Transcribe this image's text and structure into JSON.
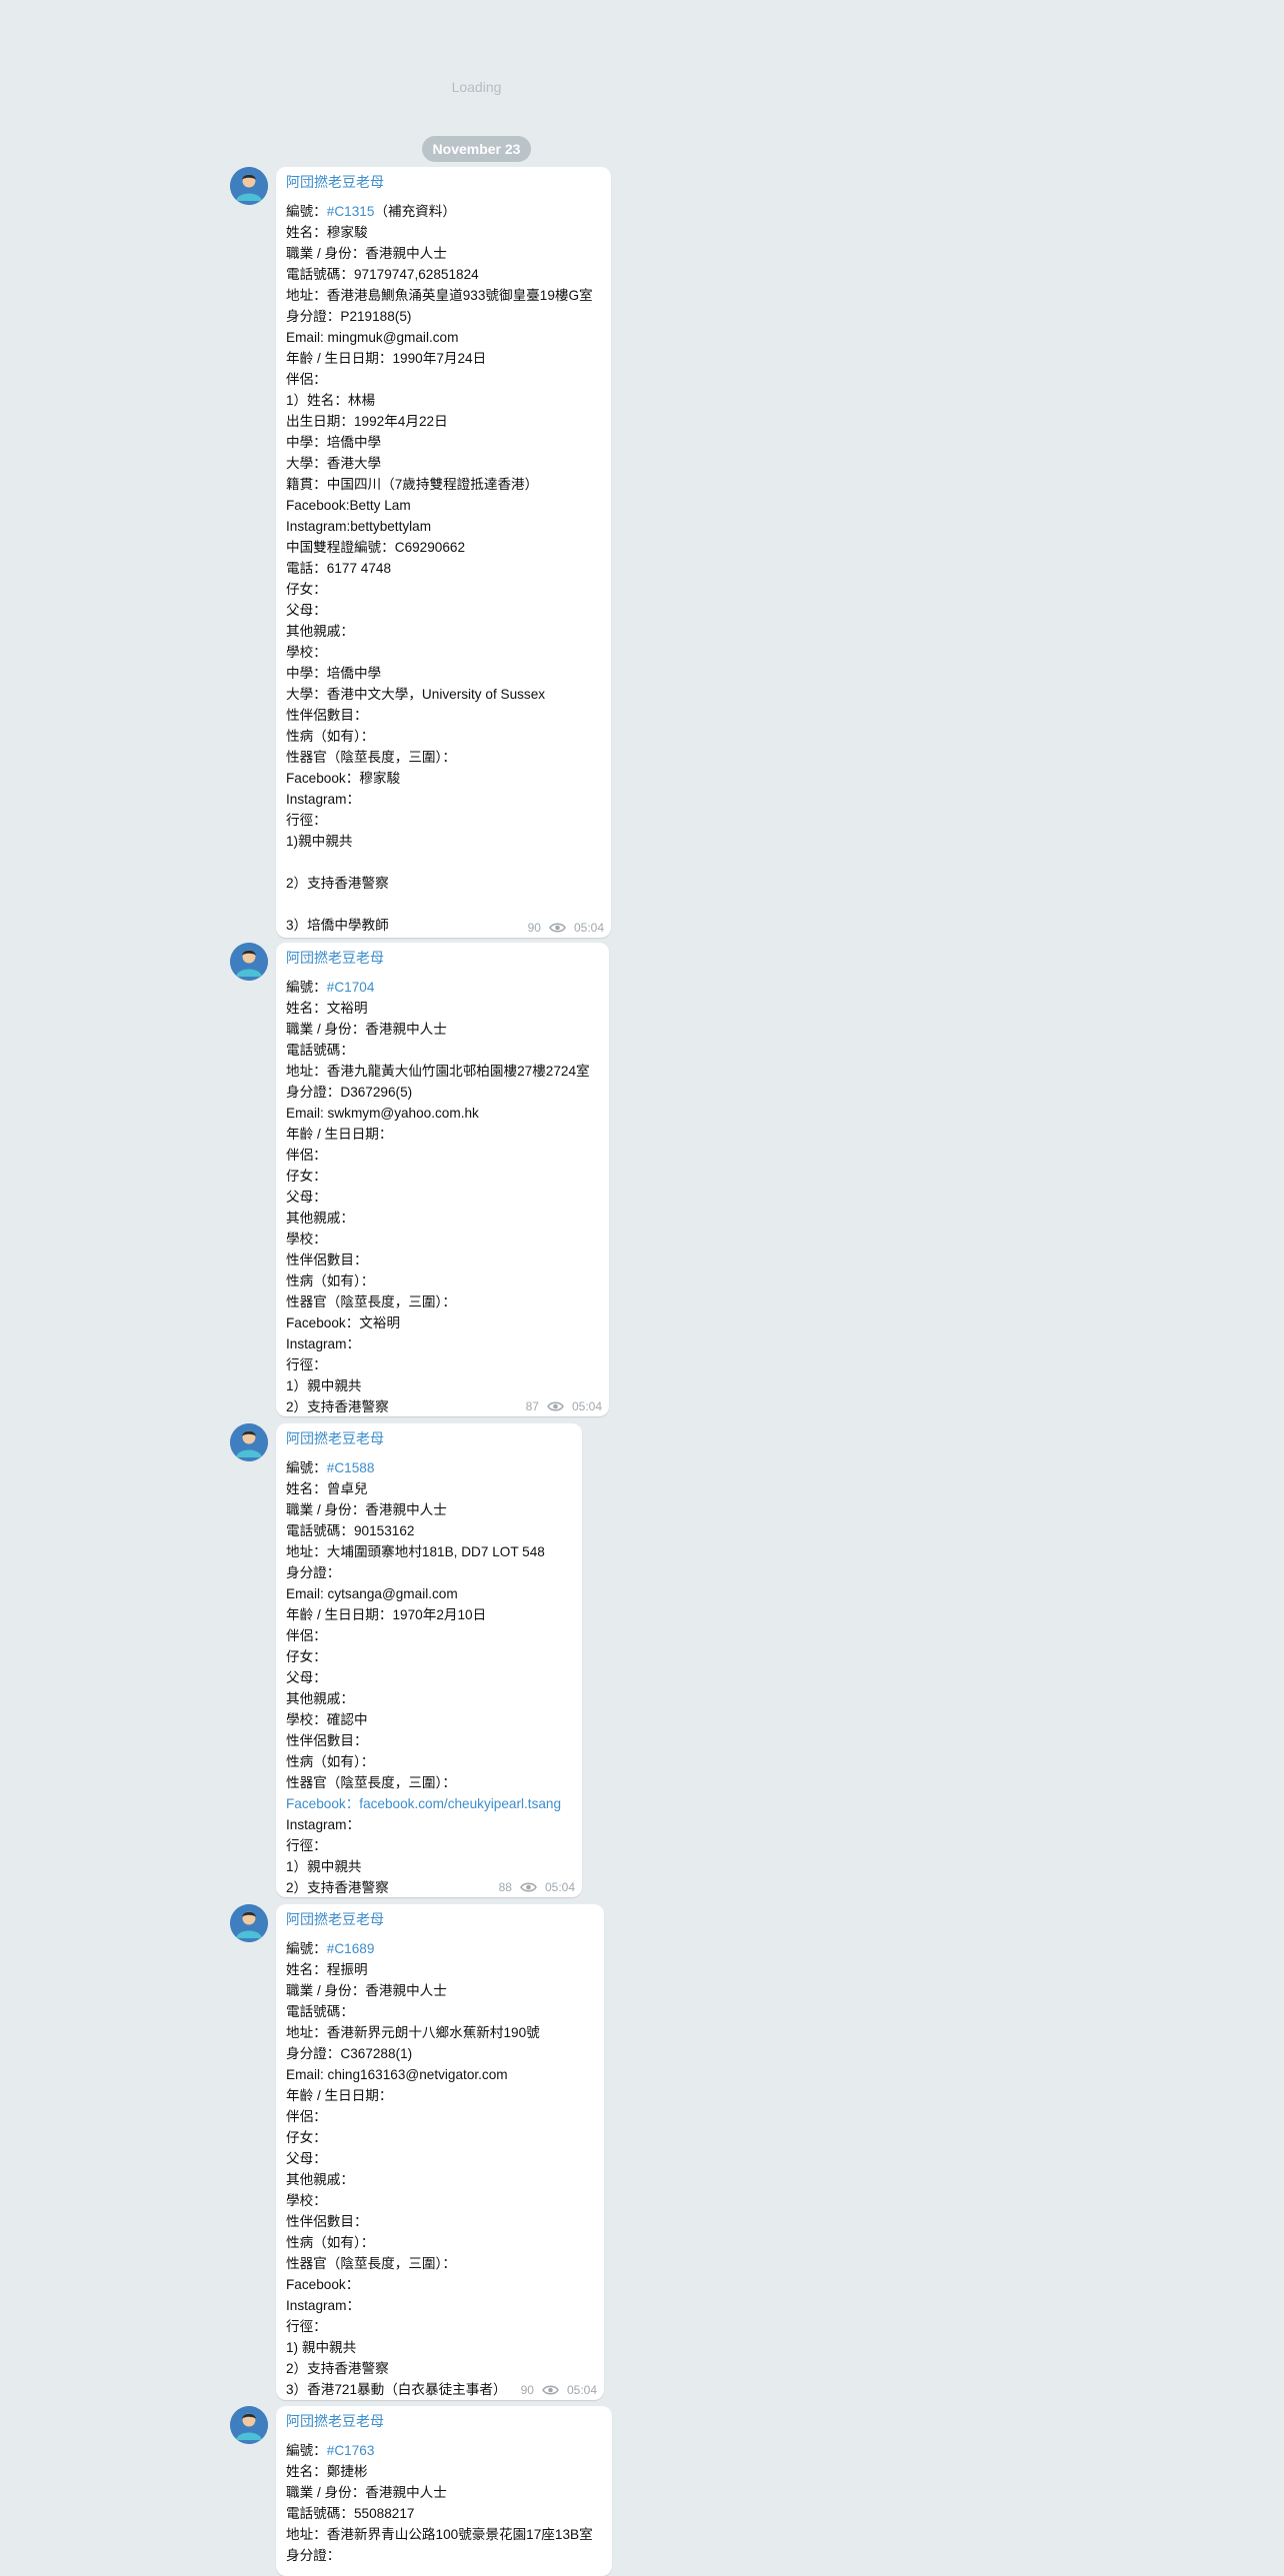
{
  "loading_text": "Loading",
  "date_label": "November 23",
  "author": "阿団撚老豆老母",
  "messages": [
    {
      "views": "90",
      "time": "05:04",
      "id_prefix": "編號：",
      "id_tag": "#C1315",
      "id_suffix": "（補充資料）",
      "lines": [
        "姓名：穆家駿",
        "職業 / 身份：香港親中人士",
        "電話號碼：97179747,62851824",
        "地址：香港港島鰂魚涌英皇道933號御皇臺19樓G室",
        "身分證：P219188(5)",
        "Email: mingmuk@gmail.com",
        "年齡 / 生日日期：1990年7月24日",
        "伴侶：",
        "1）姓名：林楊",
        "出生日期：1992年4月22日",
        "中學：培僑中學",
        "大學：香港大學",
        "籍貫：中国四川（7歲持雙程證抵達香港）",
        "Facebook:Betty Lam",
        "Instagram:bettybettylam",
        "中国雙程證編號：C69290662",
        "電話：6177 4748",
        "仔女：",
        "父母：",
        "其他親戚：",
        "學校：",
        "中學：培僑中學",
        "大學：香港中文大學，University of Sussex",
        "性伴侶數目：",
        "性病（如有）：",
        "性器官（陰莖長度，三圍）：",
        "Facebook：穆家駿",
        "Instagram：",
        "行徑：",
        "1)親中親共",
        "",
        "2）支持香港警察",
        "",
        "3）培僑中學教師"
      ]
    },
    {
      "views": "87",
      "time": "05:04",
      "id_prefix": "編號：",
      "id_tag": "#C1704",
      "id_suffix": "",
      "lines": [
        "姓名：文裕明",
        "職業 / 身份：香港親中人士",
        "電話號碼：",
        "地址：香港九龍黃大仙竹園北邨柏園樓27樓2724室",
        "身分證：D367296(5)",
        "Email: swkmym@yahoo.com.hk",
        "年齡 / 生日日期：",
        "伴侶：",
        "仔女：",
        "父母：",
        "其他親戚：",
        "學校：",
        "性伴侶數目：",
        "性病（如有）：",
        "性器官（陰莖長度，三圍）：",
        "Facebook：文裕明",
        "Instagram：",
        "行徑：",
        "1）親中親共",
        "2）支持香港警察"
      ]
    },
    {
      "views": "88",
      "time": "05:04",
      "id_prefix": "編號：",
      "id_tag": "#C1588",
      "id_suffix": "",
      "lines": [
        "姓名：曾卓兒",
        "職業 / 身份：香港親中人士",
        "電話號碼：90153162",
        "地址：大埔圍頭寨地村181B, DD7 LOT 548",
        "身分證：",
        "Email: cytsanga@gmail.com",
        "年齡 / 生日日期：1970年2月10日",
        "伴侶：",
        "仔女：",
        "父母：",
        "其他親戚：",
        "學校：確認中",
        "性伴侶數目：",
        "性病（如有）：",
        "性器官（陰莖長度，三圍）：",
        "@@Facebook：facebook.com/cheukyipearl.tsang",
        "Instagram：",
        "行徑：",
        "1）親中親共",
        "2）支持香港警察"
      ]
    },
    {
      "views": "90",
      "time": "05:04",
      "id_prefix": "編號：",
      "id_tag": "#C1689",
      "id_suffix": "",
      "lines": [
        "姓名：程振明",
        "職業 / 身份：香港親中人士",
        "電話號碼：",
        "地址：香港新界元朗十八鄉水蕉新村190號",
        "身分證：C367288(1)",
        "Email: ching163163@netvigator.com",
        "年齡 / 生日日期：",
        "伴侶：",
        "仔女：",
        "父母：",
        "其他親戚：",
        "學校：",
        "性伴侶數目：",
        "性病（如有）：",
        "性器官（陰莖長度，三圍）：",
        "Facebook：",
        "Instagram：",
        "行徑：",
        "1) 親中親共",
        "2）支持香港警察",
        "3）香港721暴動（白衣暴徒主事者）"
      ]
    },
    {
      "views": "",
      "time": "",
      "id_prefix": "編號：",
      "id_tag": "#C1763",
      "id_suffix": "",
      "lines": [
        "姓名：鄭捷彬",
        "職業 / 身份：香港親中人士",
        "電話號碼：55088217",
        "地址：香港新界青山公路100號豪景花園17座13B室",
        "身分證："
      ]
    }
  ]
}
